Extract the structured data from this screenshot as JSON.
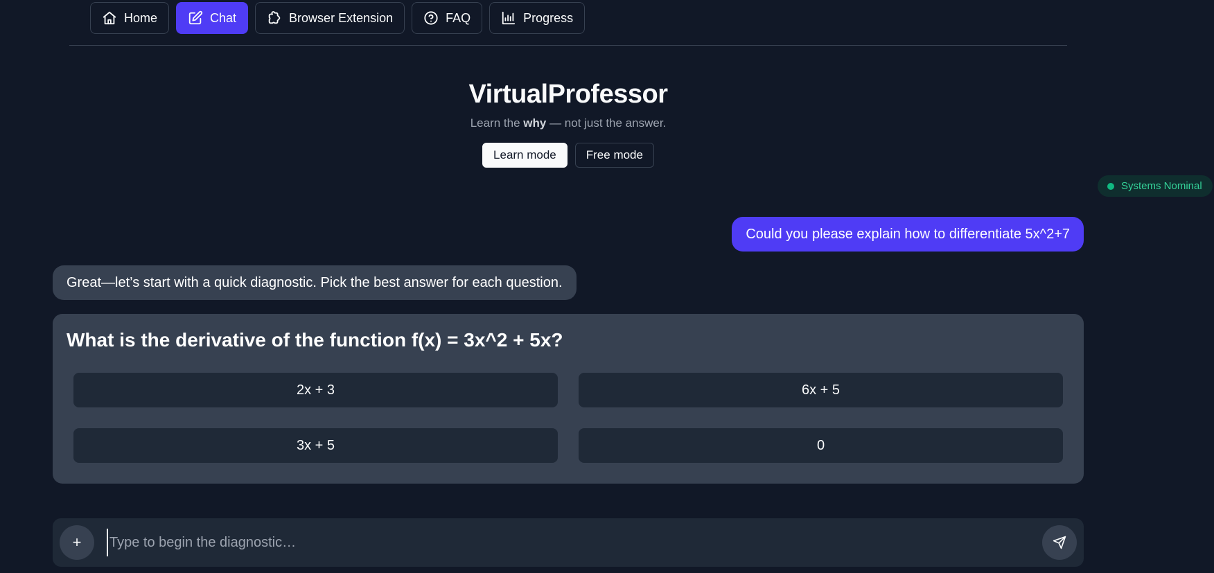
{
  "nav": {
    "items": [
      {
        "label": "Home",
        "icon": "home-icon",
        "active": false
      },
      {
        "label": "Chat",
        "icon": "edit-icon",
        "active": true
      },
      {
        "label": "Browser Extension",
        "icon": "puzzle-icon",
        "active": false
      },
      {
        "label": "FAQ",
        "icon": "help-circle-icon",
        "active": false
      },
      {
        "label": "Progress",
        "icon": "bar-chart-icon",
        "active": false
      }
    ]
  },
  "brand": {
    "title": "VirtualProfessor",
    "tag_prefix": "Learn the ",
    "tag_bold": "why",
    "tag_suffix": " — not just the answer."
  },
  "modes": {
    "learn": "Learn mode",
    "free": "Free mode",
    "selected": "Learn mode"
  },
  "status": {
    "label": "Systems Nominal",
    "color": "#10b981"
  },
  "chat": {
    "user_message": "Could you please explain how to differentiate 5x^2+7",
    "bot_message": "Great—let’s start with a quick diagnostic. Pick the best answer for each question."
  },
  "quiz": {
    "question": "What is the derivative of the function f(x) = 3x^2 + 5x?",
    "options": [
      "2x + 3",
      "6x + 5",
      "3x + 5",
      "0"
    ]
  },
  "composer": {
    "add_label": "+",
    "placeholder": "Type to begin the diagnostic…"
  },
  "colors": {
    "accent": "#4f3cf5",
    "background": "#111827",
    "surface": "#374151"
  }
}
